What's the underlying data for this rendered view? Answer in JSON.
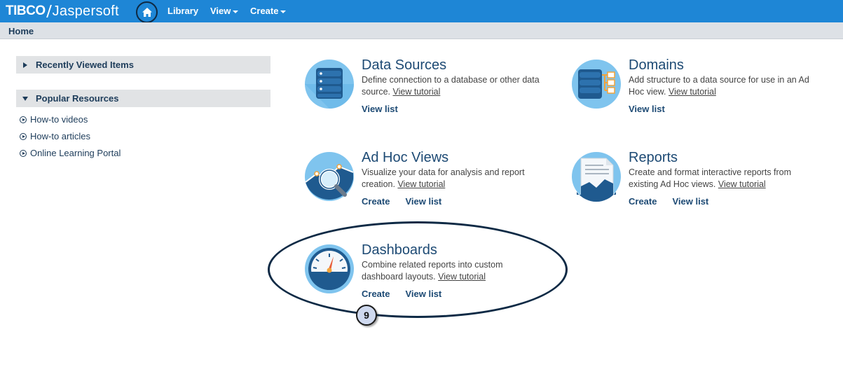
{
  "app": {
    "brand_left": "TIBCO",
    "brand_right": "Jaspersoft"
  },
  "nav": {
    "home_icon": "home-icon",
    "items": [
      {
        "label": "Library"
      },
      {
        "label": "View"
      },
      {
        "label": "Create"
      }
    ]
  },
  "breadcrumb": {
    "current": "Home"
  },
  "sidebar": {
    "recent": {
      "title": "Recently Viewed Items"
    },
    "popular": {
      "title": "Popular Resources",
      "links": [
        "How-to videos",
        "How-to articles",
        "Online Learning Portal"
      ]
    }
  },
  "tiles": {
    "data_sources": {
      "title": "Data Sources",
      "desc": "Define connection to a database or other data source.",
      "tutorial": "View tutorial",
      "view_list": "View list"
    },
    "domains": {
      "title": "Domains",
      "desc": "Add structure to a data source for use in an Ad Hoc view.",
      "tutorial": "View tutorial",
      "view_list": "View list"
    },
    "adhoc": {
      "title": "Ad Hoc Views",
      "desc": "Visualize your data for analysis and report creation.",
      "tutorial": "View tutorial",
      "create": "Create",
      "view_list": "View list"
    },
    "reports": {
      "title": "Reports",
      "desc": "Create and format interactive reports from existing Ad Hoc views.",
      "tutorial": "View tutorial",
      "create": "Create",
      "view_list": "View list"
    },
    "dashboards": {
      "title": "Dashboards",
      "desc": "Combine related reports into custom dashboard layouts.",
      "tutorial": "View tutorial",
      "create": "Create",
      "view_list": "View list"
    }
  },
  "annotation": {
    "number": "9"
  },
  "colors": {
    "topbar": "#1e86d6",
    "heading": "#1d4a74",
    "icon_circle": "#7fc4ee",
    "icon_dark": "#1f5a8f"
  }
}
